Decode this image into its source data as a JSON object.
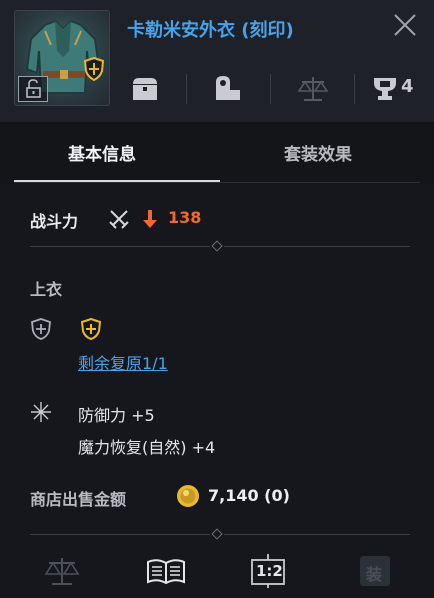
{
  "item": {
    "name": "卡勒米安外衣 (刻印)"
  },
  "toolbar": {
    "icons": [
      "chest-icon",
      "npc-icon",
      "scale-icon",
      "trophy-icon"
    ],
    "trophy_count": "4"
  },
  "tabs": [
    {
      "label": "基本信息",
      "active": true
    },
    {
      "label": "套装效果",
      "active": false
    }
  ],
  "combat": {
    "label": "战斗力",
    "trend": "down",
    "value": "138"
  },
  "slot": {
    "label": "上衣",
    "restore_link": "剩余复原1/1"
  },
  "stats": [
    "防御力 +5",
    "魔力恢复(自然) +4"
  ],
  "sale": {
    "label": "商店出售金额",
    "value": "7,140 (0)"
  },
  "bottom_bar": {
    "split_label": "1:2",
    "equip_label": "装"
  },
  "colors": {
    "title_blue": "#4aa3e8",
    "combat_red": "#f3682e",
    "gold": "#e6b833"
  }
}
